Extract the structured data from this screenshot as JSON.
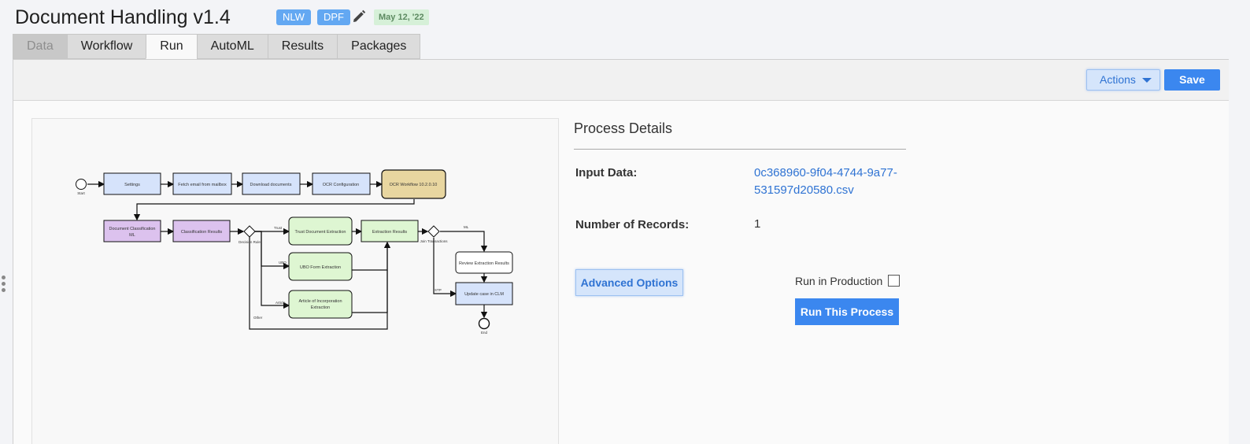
{
  "header": {
    "title": "Document Handling v1.4",
    "tags": [
      "NLW",
      "DPF"
    ],
    "date": "May 12, '22"
  },
  "tabs": [
    {
      "label": "Data",
      "state": "disabled"
    },
    {
      "label": "Workflow",
      "state": "normal"
    },
    {
      "label": "Run",
      "state": "active"
    },
    {
      "label": "AutoML",
      "state": "normal"
    },
    {
      "label": "Results",
      "state": "normal"
    },
    {
      "label": "Packages",
      "state": "normal"
    }
  ],
  "toolbar": {
    "actions_label": "Actions",
    "save_label": "Save"
  },
  "diagram": {
    "nodes": {
      "start": "Start",
      "settings": "Settings",
      "fetch": "Fetch email from mailbox",
      "download": "Download documents",
      "ocr_config": "OCR Configuration",
      "ocr_workflow": "OCR Workflow 10.2.0.10",
      "doc_class": [
        "Document Classification",
        "ML"
      ],
      "class_results": "Classification Results",
      "decision": "Decision Rule",
      "trust_doc": "Trust Document Extraction",
      "ubo_form": "UBO Form Extraction",
      "article": [
        "Article of Incorporation",
        "Extraction"
      ],
      "extraction_results": "Extraction Results",
      "join": "Join Transactions",
      "review": "Review Extraction Results",
      "update": "Update case in CLM",
      "end": "End"
    },
    "edge_labels": {
      "trust": "Trust",
      "ubo": "UBO",
      "article": "Article",
      "other": "Other",
      "ml": "ML",
      "stp": "STP"
    }
  },
  "details": {
    "title": "Process Details",
    "input_label": "Input Data:",
    "input_value_line1": "0c368960-9f04-4744-9a77-",
    "input_value_line2": "531597d20580.csv",
    "records_label": "Number of Records:",
    "records_value": "1",
    "advanced_label": "Advanced Options",
    "production_label": "Run in Production",
    "run_label": "Run This Process"
  },
  "colors": {
    "accent": "#3b87ef",
    "tag": "#63a8f2",
    "date_bg": "#d6f0d8",
    "node_blue": "#d6e3fb",
    "node_gold": "#e8d6a0",
    "node_purple": "#dcc2ee",
    "node_green": "#def6d2"
  }
}
